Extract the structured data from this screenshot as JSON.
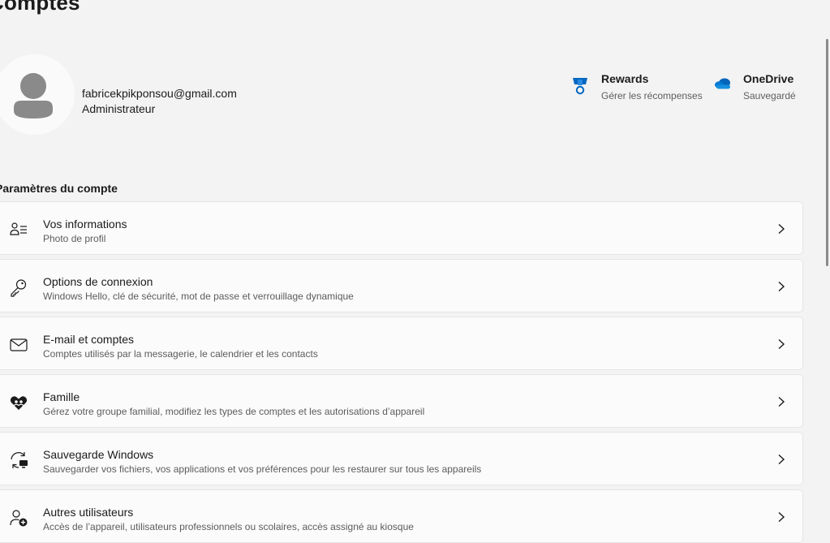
{
  "page": {
    "title": "Comptes"
  },
  "profile": {
    "email": "fabricekpikponsou@gmail.com",
    "role": "Administrateur"
  },
  "services": {
    "rewards": {
      "title": "Rewards",
      "subtitle": "Gérer les récompenses",
      "icon": "medal-icon"
    },
    "onedrive": {
      "title": "OneDrive",
      "subtitle": "Sauvegardé",
      "icon": "cloud-icon"
    }
  },
  "section": {
    "title": "Paramètres du compte"
  },
  "items": [
    {
      "title": "Vos informations",
      "subtitle": "Photo de profil",
      "icon": "person-info-icon"
    },
    {
      "title": "Options de connexion",
      "subtitle": "Windows Hello, clé de sécurité, mot de passe et verrouillage dynamique",
      "icon": "key-icon"
    },
    {
      "title": "E-mail et comptes",
      "subtitle": "Comptes utilisés par la messagerie, le calendrier et les contacts",
      "icon": "mail-icon"
    },
    {
      "title": "Famille",
      "subtitle": "Gérez votre groupe familial, modifiez les types de comptes et les autorisations d’appareil",
      "icon": "family-heart-icon"
    },
    {
      "title": "Sauvegarde Windows",
      "subtitle": "Sauvegarder vos fichiers, vos applications et vos préférences pour les restaurer sur tous les appareils",
      "icon": "backup-icon"
    },
    {
      "title": "Autres utilisateurs",
      "subtitle": "Accès de l’appareil, utilisateurs professionnels ou scolaires, accès assigné au kiosque",
      "icon": "add-user-icon"
    }
  ],
  "colors": {
    "background": "#f3f3f3",
    "card": "#fbfbfb",
    "accent": "#0067c0",
    "onedrive": "#0f6cbd"
  }
}
